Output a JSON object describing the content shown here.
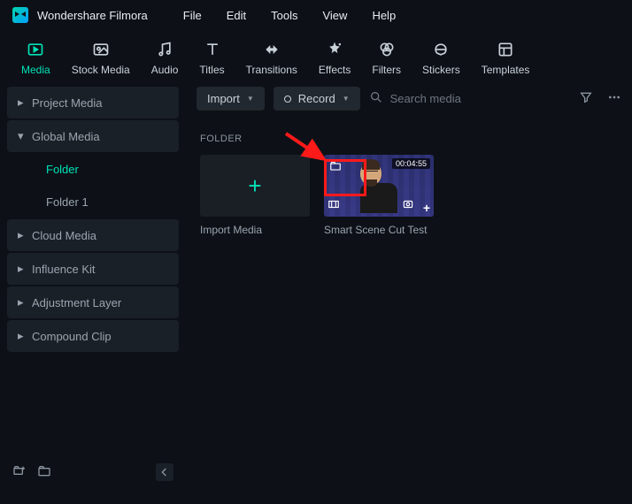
{
  "app": {
    "title": "Wondershare Filmora"
  },
  "menu": [
    "File",
    "Edit",
    "Tools",
    "View",
    "Help"
  ],
  "tabs": [
    {
      "label": "Media",
      "icon": "media",
      "active": true
    },
    {
      "label": "Stock Media",
      "icon": "stock"
    },
    {
      "label": "Audio",
      "icon": "audio"
    },
    {
      "label": "Titles",
      "icon": "titles"
    },
    {
      "label": "Transitions",
      "icon": "transitions"
    },
    {
      "label": "Effects",
      "icon": "effects"
    },
    {
      "label": "Filters",
      "icon": "filters"
    },
    {
      "label": "Stickers",
      "icon": "stickers"
    },
    {
      "label": "Templates",
      "icon": "templates"
    }
  ],
  "sidebar": {
    "items": [
      {
        "label": "Project Media",
        "expanded": false
      },
      {
        "label": "Global Media",
        "expanded": true,
        "children": [
          {
            "label": "Folder",
            "selected": true
          },
          {
            "label": "Folder 1"
          }
        ]
      },
      {
        "label": "Cloud Media"
      },
      {
        "label": "Influence Kit"
      },
      {
        "label": "Adjustment Layer"
      },
      {
        "label": "Compound Clip"
      }
    ]
  },
  "toolbar": {
    "import_label": "Import",
    "record_label": "Record",
    "search_placeholder": "Search media"
  },
  "content": {
    "section_label": "FOLDER",
    "cards": [
      {
        "type": "import",
        "label": "Import Media"
      },
      {
        "type": "clip",
        "label": "Smart Scene Cut Test",
        "duration": "00:04:55"
      }
    ]
  }
}
